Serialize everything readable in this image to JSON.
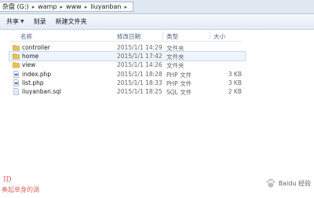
{
  "address_bar": {
    "segments": [
      "杂盘 (G:)",
      "wamp",
      "www",
      "liuyanban"
    ]
  },
  "toolbar": {
    "share": "共享",
    "burn": "刻录",
    "new_folder": "新建文件夹"
  },
  "columns": {
    "name": "名称",
    "modified": "修改日期",
    "type": "类型",
    "size": "大小"
  },
  "files": [
    {
      "name": "controller",
      "modified": "2015/1/1 14:29",
      "type": "文件夹",
      "size": "",
      "icon": "folder-icon"
    },
    {
      "name": "home",
      "modified": "2015/1/1 17:42",
      "type": "文件夹",
      "size": "",
      "icon": "folder-icon"
    },
    {
      "name": "view",
      "modified": "2015/1/1 14:26",
      "type": "文件夹",
      "size": "",
      "icon": "folder-icon"
    },
    {
      "name": "index.php",
      "modified": "2015/1/1 18:28",
      "type": "PHP 文件",
      "size": "3 KB",
      "icon": "php-file-icon"
    },
    {
      "name": "list.php",
      "modified": "2015/1/1 18:33",
      "type": "PHP 文件",
      "size": "3 KB",
      "icon": "php-file-icon"
    },
    {
      "name": "liuyanban.sql",
      "modified": "2015/1/1 18:25",
      "type": "SQL 文件",
      "size": "2 KB",
      "icon": "sql-file-icon"
    }
  ],
  "selected_row": 1,
  "watermark": {
    "line1": "ID",
    "line2": "奏起单身的调",
    "site": "Baidu 经验"
  },
  "colors": {
    "folder": "#e8c25a",
    "selection": "#eef5fd",
    "watermark": "#e06666"
  }
}
